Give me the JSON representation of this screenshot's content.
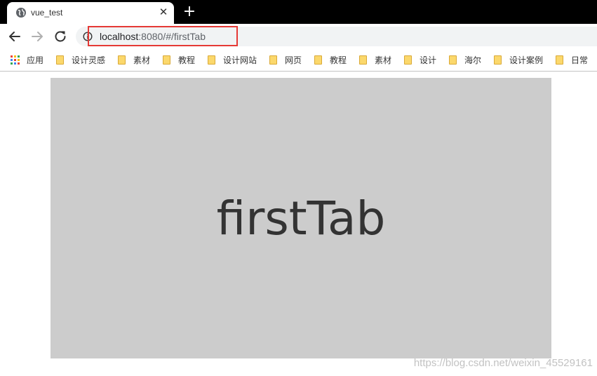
{
  "tab": {
    "title": "vue_test",
    "favicon": "globe-icon",
    "close_glyph": "✕",
    "new_tab_glyph": "+"
  },
  "toolbar": {
    "back_icon": "arrow-left-icon",
    "forward_icon": "arrow-right-icon",
    "reload_icon": "reload-icon",
    "info_icon": "info-circle-icon"
  },
  "address": {
    "host": "localhost",
    "rest": ":8080/#/firstTab"
  },
  "bookmarks": {
    "apps_label": "应用",
    "items": [
      {
        "label": "设计灵感"
      },
      {
        "label": "素材"
      },
      {
        "label": "教程"
      },
      {
        "label": "设计网站"
      },
      {
        "label": "网页"
      },
      {
        "label": "教程"
      },
      {
        "label": "素材"
      },
      {
        "label": "设计"
      },
      {
        "label": "海尔"
      },
      {
        "label": "设计案例"
      },
      {
        "label": "日常"
      }
    ]
  },
  "content": {
    "text": "firstTab"
  },
  "watermark": "https://blog.csdn.net/weixin_45529161",
  "colors": {
    "tabstrip": "#000000",
    "omnibox": "#f1f3f4",
    "highlight": "#e53935",
    "content_bg": "#cccccc",
    "folder": "#fbd86c"
  }
}
